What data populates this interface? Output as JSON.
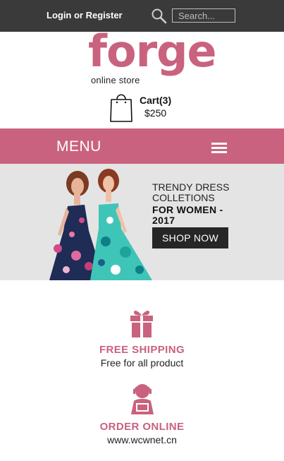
{
  "header": {
    "login_label": "Login or Register",
    "search": {
      "placeholder": "Search...",
      "icon": "search-icon"
    }
  },
  "brand": {
    "name": "forge",
    "tagline": "online store",
    "color": "#c9627f"
  },
  "cart": {
    "label": "Cart(3)",
    "total": "$250",
    "icon": "shopping-bag-icon"
  },
  "menu": {
    "label": "MENU",
    "icon": "hamburger-icon"
  },
  "banner": {
    "line1": "TRENDY DRESS COLLETIONS",
    "line2": "FOR WOMEN - 2017",
    "button_label": "SHOP NOW"
  },
  "features": [
    {
      "title": "FREE SHIPPING",
      "subtitle": "Free for all product",
      "icon": "gift-icon"
    },
    {
      "title": "ORDER ONLINE",
      "subtitle": "www.wcwnet.cn",
      "icon": "customer-support-icon"
    }
  ],
  "colors": {
    "accent": "#c9627f",
    "topbar": "#3a3a3a",
    "banner_bg": "#e4e4e4",
    "button_bg": "#262626"
  }
}
